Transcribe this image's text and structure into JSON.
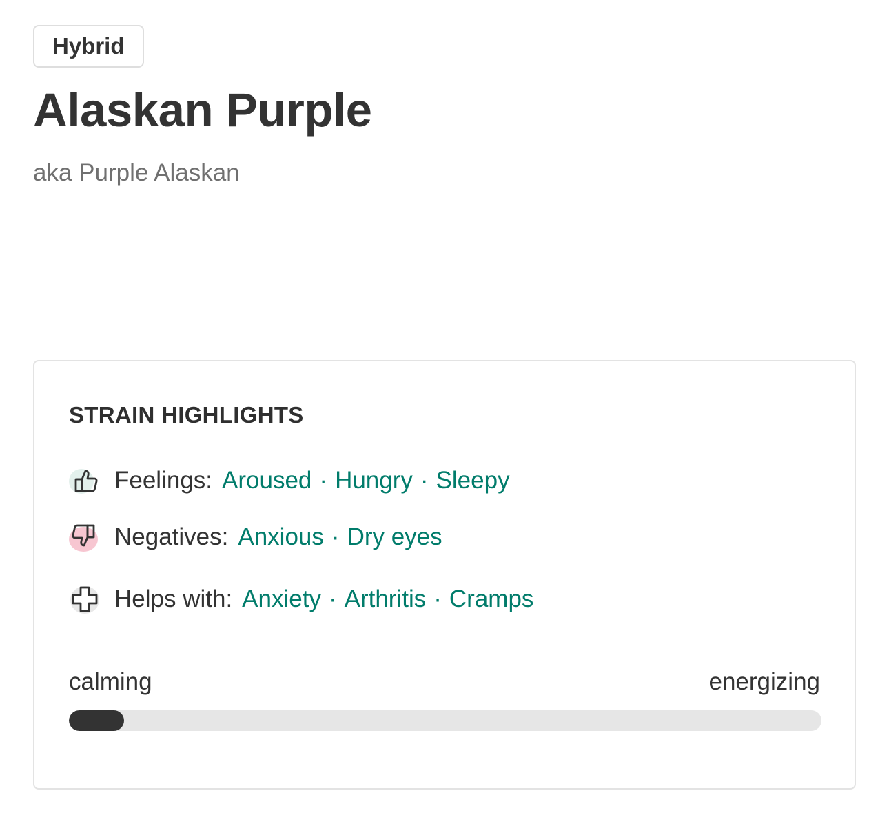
{
  "strain": {
    "type_badge": "Hybrid",
    "name": "Alaskan Purple",
    "aka": "aka Purple Alaskan"
  },
  "highlights": {
    "heading": "STRAIN HIGHLIGHTS",
    "feelings": {
      "label": "Feelings:",
      "icon": "thumbs-up-icon",
      "items": [
        "Aroused",
        "Hungry",
        "Sleepy"
      ]
    },
    "negatives": {
      "label": "Negatives:",
      "icon": "thumbs-down-icon",
      "items": [
        "Anxious",
        "Dry eyes"
      ]
    },
    "helps_with": {
      "label": "Helps with:",
      "icon": "medical-cross-icon",
      "items": [
        "Anxiety",
        "Arthritis",
        "Cramps"
      ]
    },
    "separator": "·",
    "scale": {
      "left_label": "calming",
      "right_label": "energizing",
      "level_fraction": 0.073
    }
  },
  "colors": {
    "text": "#333333",
    "muted_text": "#707070",
    "link_green": "#017c6b",
    "track": "#e6e6e6",
    "fill": "#333333",
    "positive_blob": "#e3f0ec",
    "negative_blob": "#f7c6d1",
    "helps_blob": "#e8e8e8"
  }
}
